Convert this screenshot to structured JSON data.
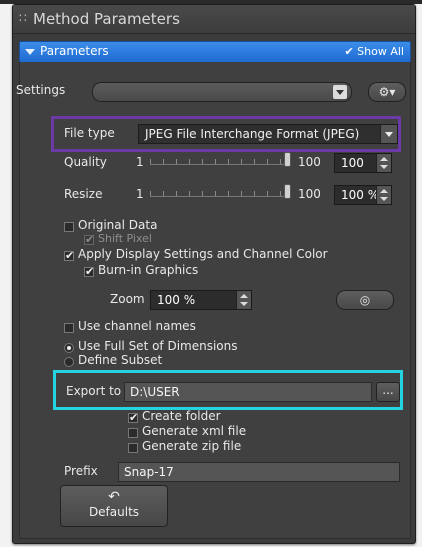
{
  "window": {
    "title": "Method Parameters"
  },
  "section": {
    "label": "Parameters",
    "show_all": "Show All"
  },
  "settings": {
    "label": "Settings",
    "value": "",
    "gear_label": ""
  },
  "file_type": {
    "label": "File type",
    "value": "JPEG File Interchange Format (JPEG)"
  },
  "quality": {
    "label": "Quality",
    "min": "1",
    "max": "100",
    "value": "100",
    "level": 1.0
  },
  "resize": {
    "label": "Resize",
    "min": "1",
    "max": "100",
    "value": "100 %",
    "level": 1.0
  },
  "options": {
    "original_data": "Original Data",
    "shift_pixel": "Shift Pixel",
    "apply_display": "Apply Display Settings and Channel Color",
    "burn_in": "Burn-in Graphics",
    "zoom_label": "Zoom",
    "zoom_value": "100 %",
    "use_channel_names": "Use channel names",
    "use_full_set": "Use Full Set of Dimensions",
    "define_subset": "Define Subset"
  },
  "export": {
    "label": "Export to",
    "path": "D:\\USER",
    "browse": "...",
    "create_folder": "Create folder",
    "generate_xml": "Generate xml file",
    "generate_zip": "Generate zip file"
  },
  "prefix": {
    "label": "Prefix",
    "value": "Snap-17"
  },
  "defaults": {
    "label": "Defaults"
  },
  "colors": {
    "accent_blue": "#1f6bd1",
    "highlight_purple": "#6b3aa6",
    "highlight_cyan": "#25d4e0",
    "panel_bg": "#404040"
  }
}
